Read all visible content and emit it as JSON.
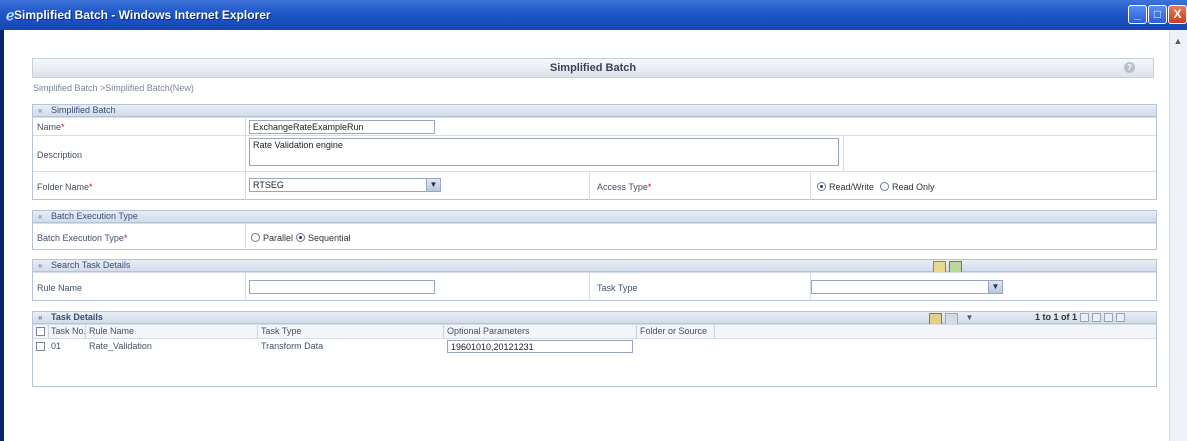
{
  "window": {
    "title": "Simplified Batch - Windows Internet Explorer",
    "minimize": "_",
    "maximize": "□",
    "close": "X"
  },
  "page": {
    "header": "Simplified Batch",
    "breadcrumb": "Simplified Batch >Simplified Batch(New)"
  },
  "simplified_batch": {
    "section_title": "Simplified Batch",
    "name_label": "Name",
    "name_value": "ExchangeRateExampleRun",
    "description_label": "Description",
    "description_value": "Rate Validation engine",
    "folder_label": "Folder Name",
    "folder_value": "RTSEG",
    "access_label": "Access Type",
    "access_options": [
      "Read/Write",
      "Read Only"
    ],
    "access_selected": "Read/Write"
  },
  "batch_execution": {
    "section_title": "Batch Execution Type",
    "label": "Batch Execution Type",
    "options": [
      "Parallel",
      "Sequential"
    ],
    "selected": "Sequential"
  },
  "search_task": {
    "section_title": "Search Task Details",
    "rule_name_label": "Rule Name",
    "rule_name_value": "",
    "task_type_label": "Task Type",
    "task_type_value": ""
  },
  "task_details": {
    "section_title": "Task Details",
    "pager": "1 to 1 of 1",
    "columns": [
      "Task No.",
      "Rule Name",
      "Task Type",
      "Optional Parameters",
      "Folder or Source"
    ],
    "rows": [
      {
        "task_no": "01",
        "rule_name": "Rate_Validation",
        "task_type": "Transform Data",
        "optional_parameters": "19601010,20121231",
        "folder_or_source": ""
      }
    ]
  },
  "colors": {
    "titlebar": "#1e56c8",
    "section_header": "#d2dbe9",
    "required": "#d0021b"
  },
  "icons": [
    "ie-logo-icon",
    "help-icon",
    "collapse-arrow-icon",
    "dropdown-arrow-icon",
    "search-icon",
    "reset-icon",
    "add-icon",
    "delete-icon",
    "filter-icon",
    "first-page-icon",
    "prev-page-icon",
    "next-page-icon",
    "last-page-icon"
  ]
}
